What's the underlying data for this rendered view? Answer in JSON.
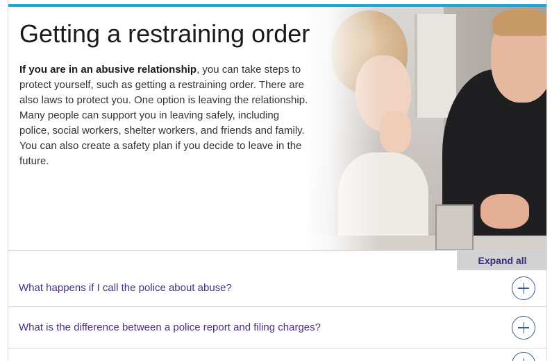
{
  "hero": {
    "title": "Getting a restraining order",
    "intro_bold": "If you are in an abusive relationship",
    "intro_rest": ", you can take steps to protect yourself, such as getting a restraining order. There are also laws to protect you. One option is leaving the relationship. Many people can support you in leaving safely, including police, social workers, shelter workers, and friends and family. You can also create a safety plan if you decide to leave in the future."
  },
  "accordion": {
    "expand_all_label": "Expand all",
    "items": [
      {
        "question": "What happens if I call the police about abuse?"
      },
      {
        "question": "What is the difference between a police report and filing charges?"
      },
      {
        "question": ""
      }
    ]
  },
  "colors": {
    "accent_bar": "#1ea7d6",
    "link_purple": "#4a2f86",
    "expand_button_bg": "#d2d2d2"
  },
  "icons": {
    "expand": "plus-circle-icon"
  }
}
